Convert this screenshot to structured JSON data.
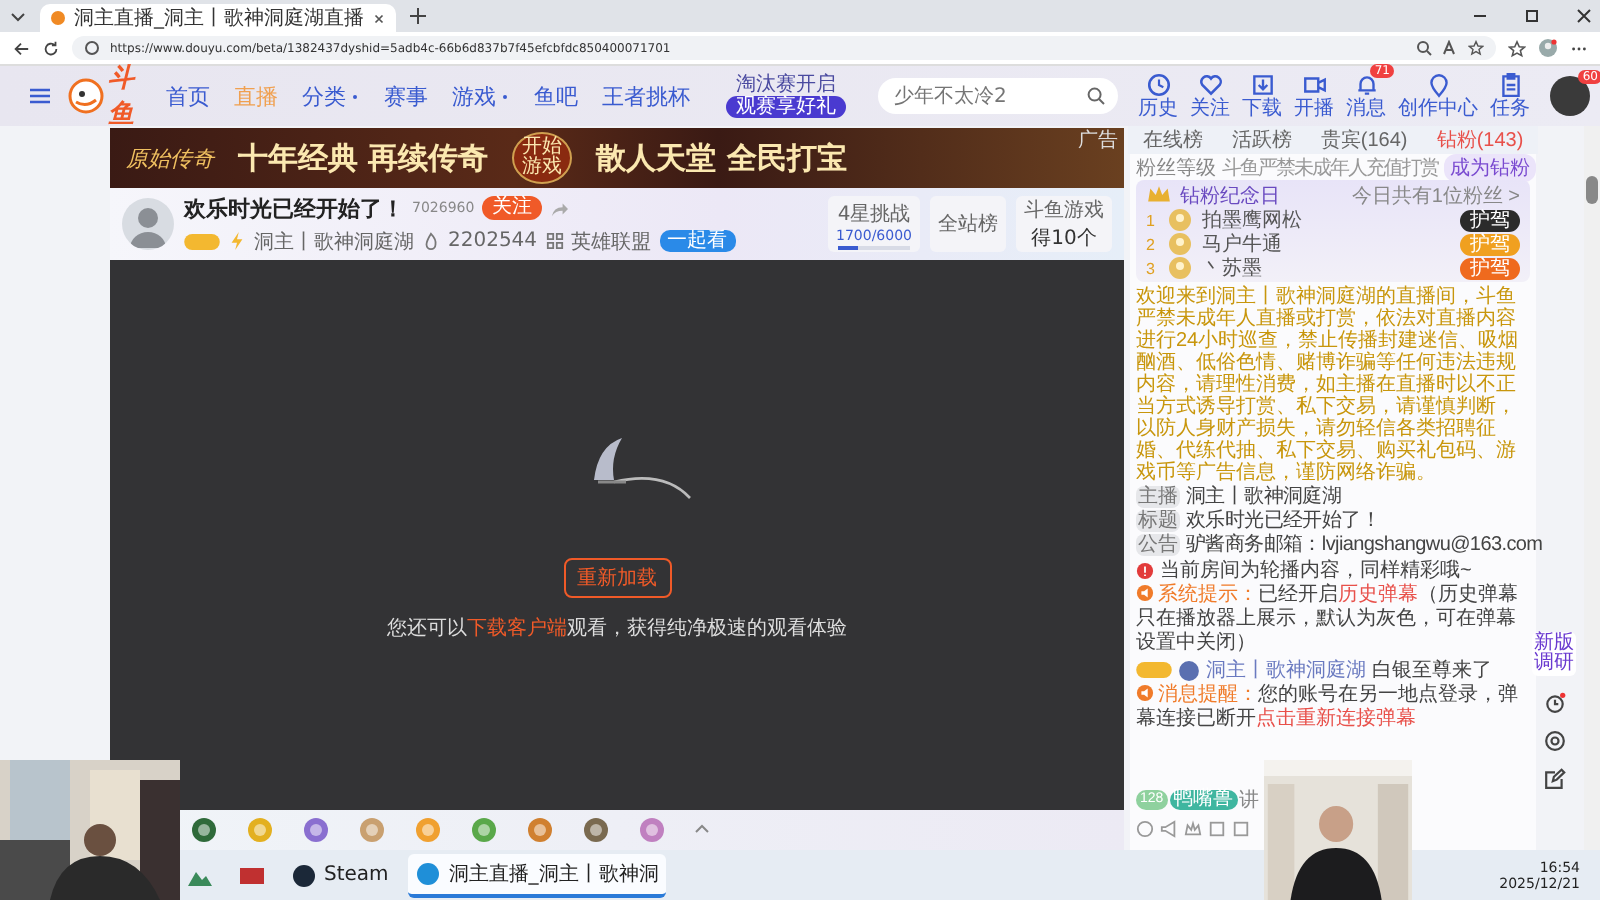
{
  "browser": {
    "tab_title": "洞主直播_洞主丨歌神洞庭湖直播",
    "url": "https://www.douyu.com/beta/1382437dyshid=5adb4c-66b6d837b7f45efcbfdc850400071701"
  },
  "header": {
    "logo": "斗鱼",
    "nav": [
      {
        "label": "首页",
        "selected": false,
        "dropdown": false
      },
      {
        "label": "直播",
        "selected": true,
        "dropdown": false
      },
      {
        "label": "分类",
        "selected": false,
        "dropdown": true
      },
      {
        "label": "赛事",
        "selected": false,
        "dropdown": false
      },
      {
        "label": "游戏",
        "selected": false,
        "dropdown": true
      },
      {
        "label": "鱼吧",
        "selected": false,
        "dropdown": false
      },
      {
        "label": "王者挑杯",
        "selected": false,
        "dropdown": false
      }
    ],
    "promo": {
      "line1": "淘汰赛开启",
      "line2": "观赛享好礼"
    },
    "search": {
      "placeholder": "少年不太冷2"
    },
    "actions": [
      {
        "label": "历史",
        "kind": "clock"
      },
      {
        "label": "关注",
        "kind": "heart"
      },
      {
        "label": "下载",
        "kind": "download"
      },
      {
        "label": "开播",
        "kind": "camera"
      },
      {
        "label": "消息",
        "kind": "bell",
        "badge": "71"
      },
      {
        "label": "创作中心",
        "kind": "pin"
      },
      {
        "label": "任务",
        "kind": "clipboard"
      }
    ],
    "avatar_badge": "60"
  },
  "banner": {
    "logo": "原始传奇",
    "slogan_left": "十年经典 再续传奇",
    "button": "开始游戏",
    "slogan_right": "散人天堂 全民打宝",
    "ad_label": "广告"
  },
  "room": {
    "title": "欢乐时光已经开始了！",
    "room_id": "7026960",
    "follow": "关注",
    "streamer": "洞主丨歌神洞庭湖",
    "hot": "2202544",
    "category": "英雄联盟",
    "tag": "一起看",
    "stats": [
      {
        "kind": "progress",
        "label": "4星挑战",
        "value": "1700/6000",
        "level": 0.28
      },
      {
        "kind": "plain",
        "label": "全站榜"
      },
      {
        "kind": "reward",
        "label": "斗鱼游戏",
        "value": "得10个"
      }
    ]
  },
  "player": {
    "reload": "重新加载",
    "hint_before": "您还可以",
    "hint_link": "下载客户端",
    "hint_after": "观看，获得纯净极速的观看体验"
  },
  "panel": {
    "tabs": [
      {
        "label": "在线榜",
        "selected": false
      },
      {
        "label": "活跃榜",
        "selected": false
      },
      {
        "label": "贵宾(164)",
        "selected": false
      },
      {
        "label": "钻粉(143)",
        "selected": true
      }
    ],
    "fan_level": "粉丝等级",
    "fan_notice": "斗鱼严禁未成年人充值打赏",
    "join": "成为钻粉",
    "anniversary": {
      "title": "钻粉纪念日",
      "summary": "今日共有1位粉丝 >",
      "fans": [
        {
          "rank": "1",
          "name": "拍墨鹰网松",
          "badge": "护驾",
          "color": "#2b2b2b"
        },
        {
          "rank": "2",
          "name": "马户牛通",
          "badge": "护驾",
          "color": "#f0a020"
        },
        {
          "rank": "3",
          "name": "丶苏墨",
          "badge": "护驾",
          "color": "#ef6a1e"
        }
      ]
    },
    "welcome": "欢迎来到洞主丨歌神洞庭湖的直播间，斗鱼严禁未成年人直播或打赏，依法对直播内容进行24小时巡查，禁止传播封建迷信、吸烟酗酒、低俗色情、赌博诈骗等任何违法违规内容，请理性消费，如主播在直播时以不正当方式诱导打赏、私下交易，请谨慎判断，以防人身财产损失，请勿轻信各类招聘征婚、代练代抽、私下交易、购买礼包码、游戏币等广告信息，谨防网络诈骗。",
    "info": [
      {
        "label": "主播",
        "value": "洞主丨歌神洞庭湖"
      },
      {
        "label": "标题",
        "value": "欢乐时光已经开始了！"
      },
      {
        "label": "公告",
        "value": "驴酱商务邮箱：lvjiangshangwu@163.com"
      }
    ],
    "messages": [
      {
        "kind": "notice",
        "text": "当前房间为轮播内容，同样精彩哦~"
      },
      {
        "kind": "system",
        "label": "系统提示：",
        "before": "已经开启",
        "link": "历史弹幕",
        "after": "（历史弹幕只在播放器上展示，默认为灰色，可在弹幕设置中关闭）"
      },
      {
        "kind": "enter",
        "name": "洞主丨歌神洞庭湖",
        "text": "白银至尊来了"
      },
      {
        "kind": "system",
        "label": "消息提醒：",
        "before": "您的账号在另一地点登录，弹幕连接已断开",
        "link": "点击重新连接弹幕"
      }
    ],
    "chat_badges": [
      {
        "text": "128",
        "color": "#8fd19e"
      },
      {
        "text": "鸭嘴兽",
        "color": "#3fb6a0"
      }
    ],
    "chat_hint": "讲"
  },
  "side_tools": {
    "survey": "新版调研"
  },
  "taskbar": {
    "apps": [
      {
        "kind": "photos",
        "selected": false
      },
      {
        "kind": "news",
        "selected": false
      },
      {
        "kind": "steam",
        "label": "Steam",
        "selected": false
      },
      {
        "kind": "edge",
        "label": "洞主直播_洞主丨歌神洞",
        "selected": true
      }
    ],
    "time": "16:54",
    "date": "2025/12/21"
  }
}
